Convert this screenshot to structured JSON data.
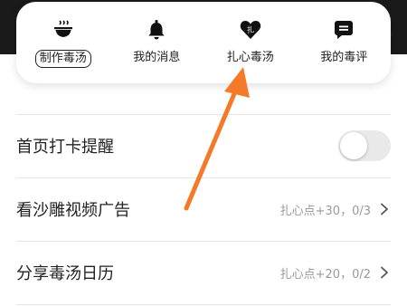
{
  "popup_menu": {
    "items": [
      {
        "icon": "soup-bowl-icon",
        "label": "制作毒汤",
        "selected": true
      },
      {
        "icon": "bell-icon",
        "label": "我的消息",
        "selected": false
      },
      {
        "icon": "heart-icon",
        "icon_text": "扎",
        "label": "扎心毒汤",
        "selected": false
      },
      {
        "icon": "speech-bubble-icon",
        "label": "我的毒评",
        "selected": false
      }
    ]
  },
  "settings": {
    "checkin_reminder": {
      "label": "首页打卡提醒",
      "toggle_on": false
    },
    "watch_video_ad": {
      "label": "看沙雕视频广告",
      "value": "扎心点+30，0/3"
    },
    "share_calendar": {
      "label": "分享毒汤日历",
      "value": "扎心点+20，0/2"
    }
  },
  "colors": {
    "annotation_arrow": "#f47a2a",
    "toggle_off_track": "#e9e9e9"
  }
}
